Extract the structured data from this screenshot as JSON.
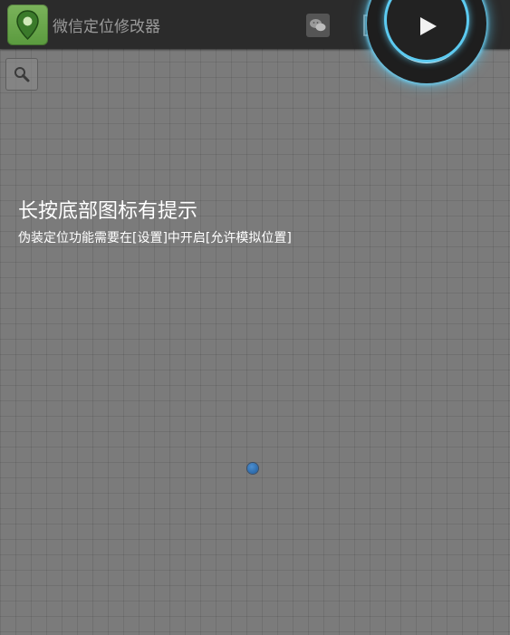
{
  "actionbar": {
    "app_title": "微信定位修改器",
    "app_icon": "map-pin-icon",
    "wechat_button_icon": "wechat-icon",
    "list_button_icon": "list-icon",
    "play_button_icon": "play-icon",
    "more_button_icon": "more-vertical-icon"
  },
  "map": {
    "search_button_icon": "search-icon",
    "hint_title": "长按底部图标有提示",
    "hint_subtitle": "伪装定位功能需要在[设置]中开启[允许模拟位置]",
    "location_marker": "location-dot"
  },
  "colors": {
    "actionbar_bg": "#2b2b2b",
    "map_bg": "#7b7b7b",
    "play_glow": "#5ccaf0",
    "app_icon_green": "#6aa84f",
    "marker_blue": "#2f6fb4"
  }
}
